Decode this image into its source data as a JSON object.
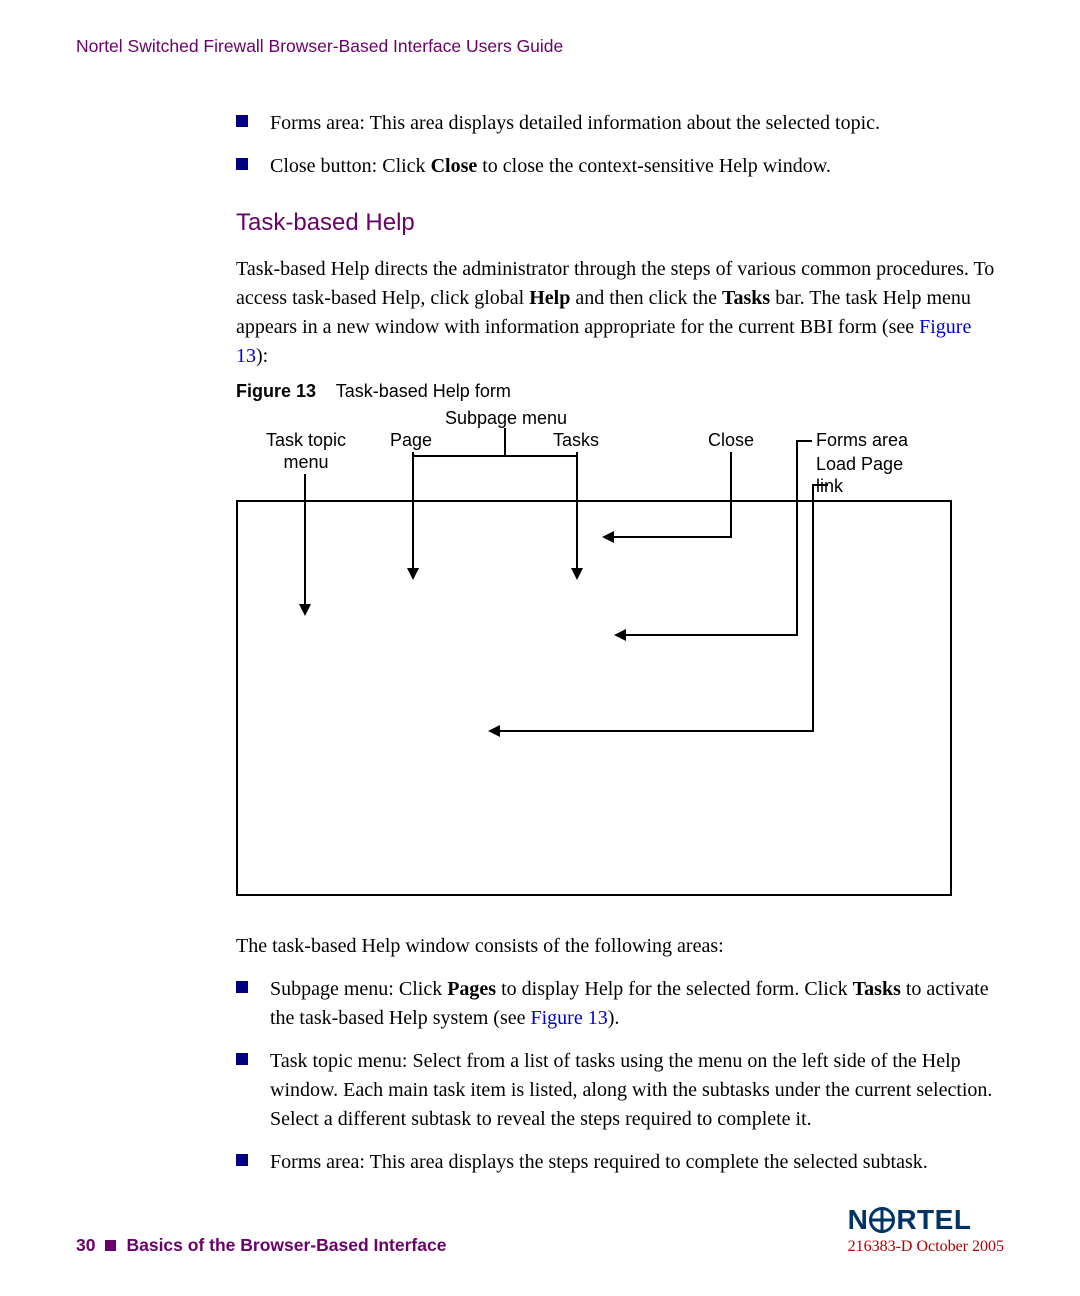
{
  "header": {
    "title": "Nortel Switched Firewall Browser-Based Interface Users Guide"
  },
  "top_bullets": [
    {
      "text": "Forms area: This area displays detailed information about the selected topic."
    },
    {
      "pre": "Close button: Click ",
      "b1": "Close",
      "post": " to close the context-sensitive Help window."
    }
  ],
  "section": {
    "heading": "Task-based Help",
    "p1_a": "Task-based Help directs the administrator through the steps of various common procedures. To access task-based Help, click global ",
    "p1_b1": "Help",
    "p1_b": " and then click the ",
    "p1_b2": "Tasks",
    "p1_c": "  bar. The task Help menu appears in a new window with information appropriate for the current BBI form (see ",
    "p1_link": "Figure 13",
    "p1_d": "):"
  },
  "figure": {
    "number": "Figure 13",
    "title": "Task-based Help form",
    "labels": {
      "subpage_menu": "Subpage menu",
      "task_topic_menu_l1": "Task topic",
      "task_topic_menu_l2": "menu",
      "page": "Page",
      "tasks": "Tasks",
      "close": "Close",
      "forms_area": "Forms  area",
      "load_page_l1": "Load Page",
      "load_page_l2": "link"
    }
  },
  "after_fig_para": "The task-based Help window consists of the following areas:",
  "bottom_bullets": [
    {
      "a": "Subpage menu: Click ",
      "b1": "Pages",
      "b": " to display Help for the selected form. Click ",
      "b2": "Tasks",
      "c": " to activate the task-based Help system (see ",
      "link": "Figure 13",
      "d": ")."
    },
    {
      "text": "Task topic menu: Select from a list of tasks using the menu on the left side of the Help window. Each main task item is listed, along with the subtasks under the current selection. Select a different subtask to reveal the steps required to complete it."
    },
    {
      "text": "Forms area: This area displays the steps required to complete the selected subtask."
    }
  ],
  "footer": {
    "page_number": "30",
    "chapter": "Basics of the Browser-Based Interface",
    "logo_text_left": "N",
    "logo_text_right": "RTEL",
    "doc_id": "216383-D October 2005"
  }
}
